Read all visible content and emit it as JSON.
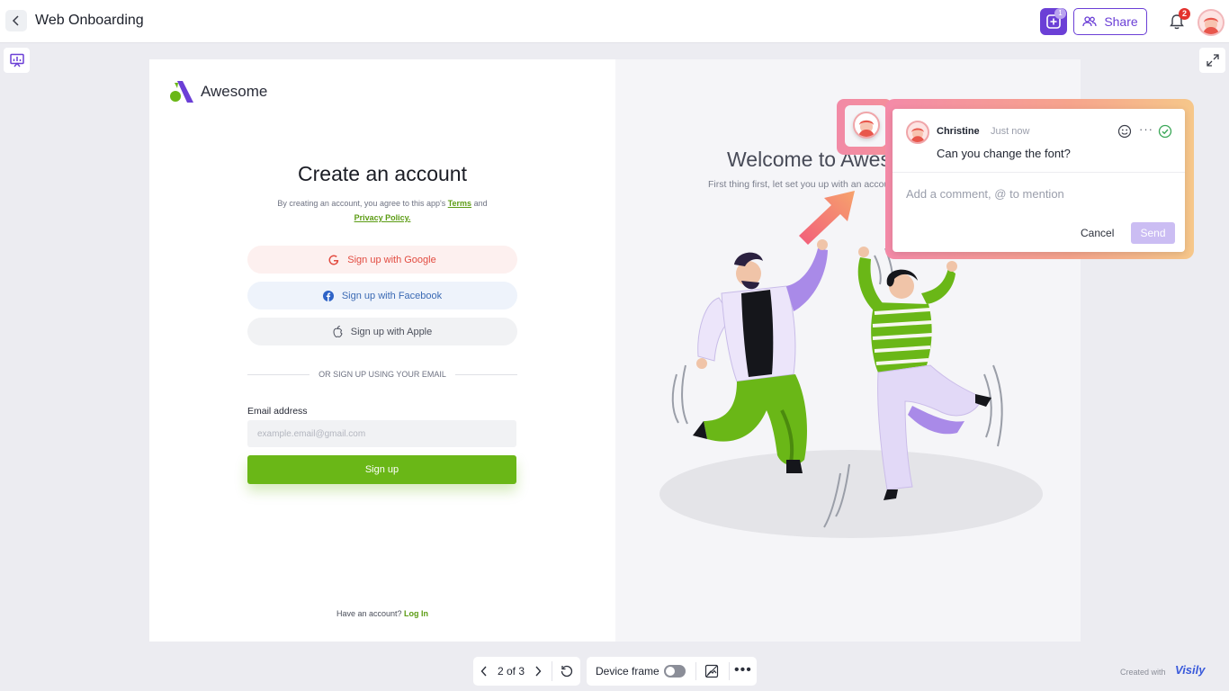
{
  "topbar": {
    "title": "Web Onboarding",
    "add_count": "1",
    "share_label": "Share",
    "notification_count": "2"
  },
  "signup": {
    "brand": "Awesome",
    "title": "Create an account",
    "terms_prefix": "By creating an account, you agree to this app's ",
    "terms_link": "Terms",
    "terms_and": " and",
    "privacy_link": "Privacy Policy.",
    "google_label": "Sign up with Google",
    "facebook_label": "Sign up with Facebook",
    "apple_label": "Sign up with Apple",
    "divider": "OR SIGN UP USING YOUR EMAIL",
    "email_label": "Email address",
    "email_placeholder": "example.email@gmail.com",
    "submit_label": "Sign up",
    "have_account": "Have an account? ",
    "login_link": "Log In"
  },
  "welcome": {
    "title": "Welcome to Awesome",
    "subtitle": "First thing first, let set you up with an account"
  },
  "comment": {
    "author": "Christine",
    "time": "Just now",
    "text": "Can you change the font?",
    "input_placeholder": "Add a comment, @ to mention",
    "cancel_label": "Cancel",
    "send_label": "Send"
  },
  "bottom": {
    "pager": "2 of 3",
    "device_frame_label": "Device frame",
    "created_with": "Created with",
    "brand": "Visily"
  },
  "colors": {
    "accent": "#6b3fd6",
    "primary_green": "#6ab717",
    "send_disabled": "#cbbdf3"
  }
}
